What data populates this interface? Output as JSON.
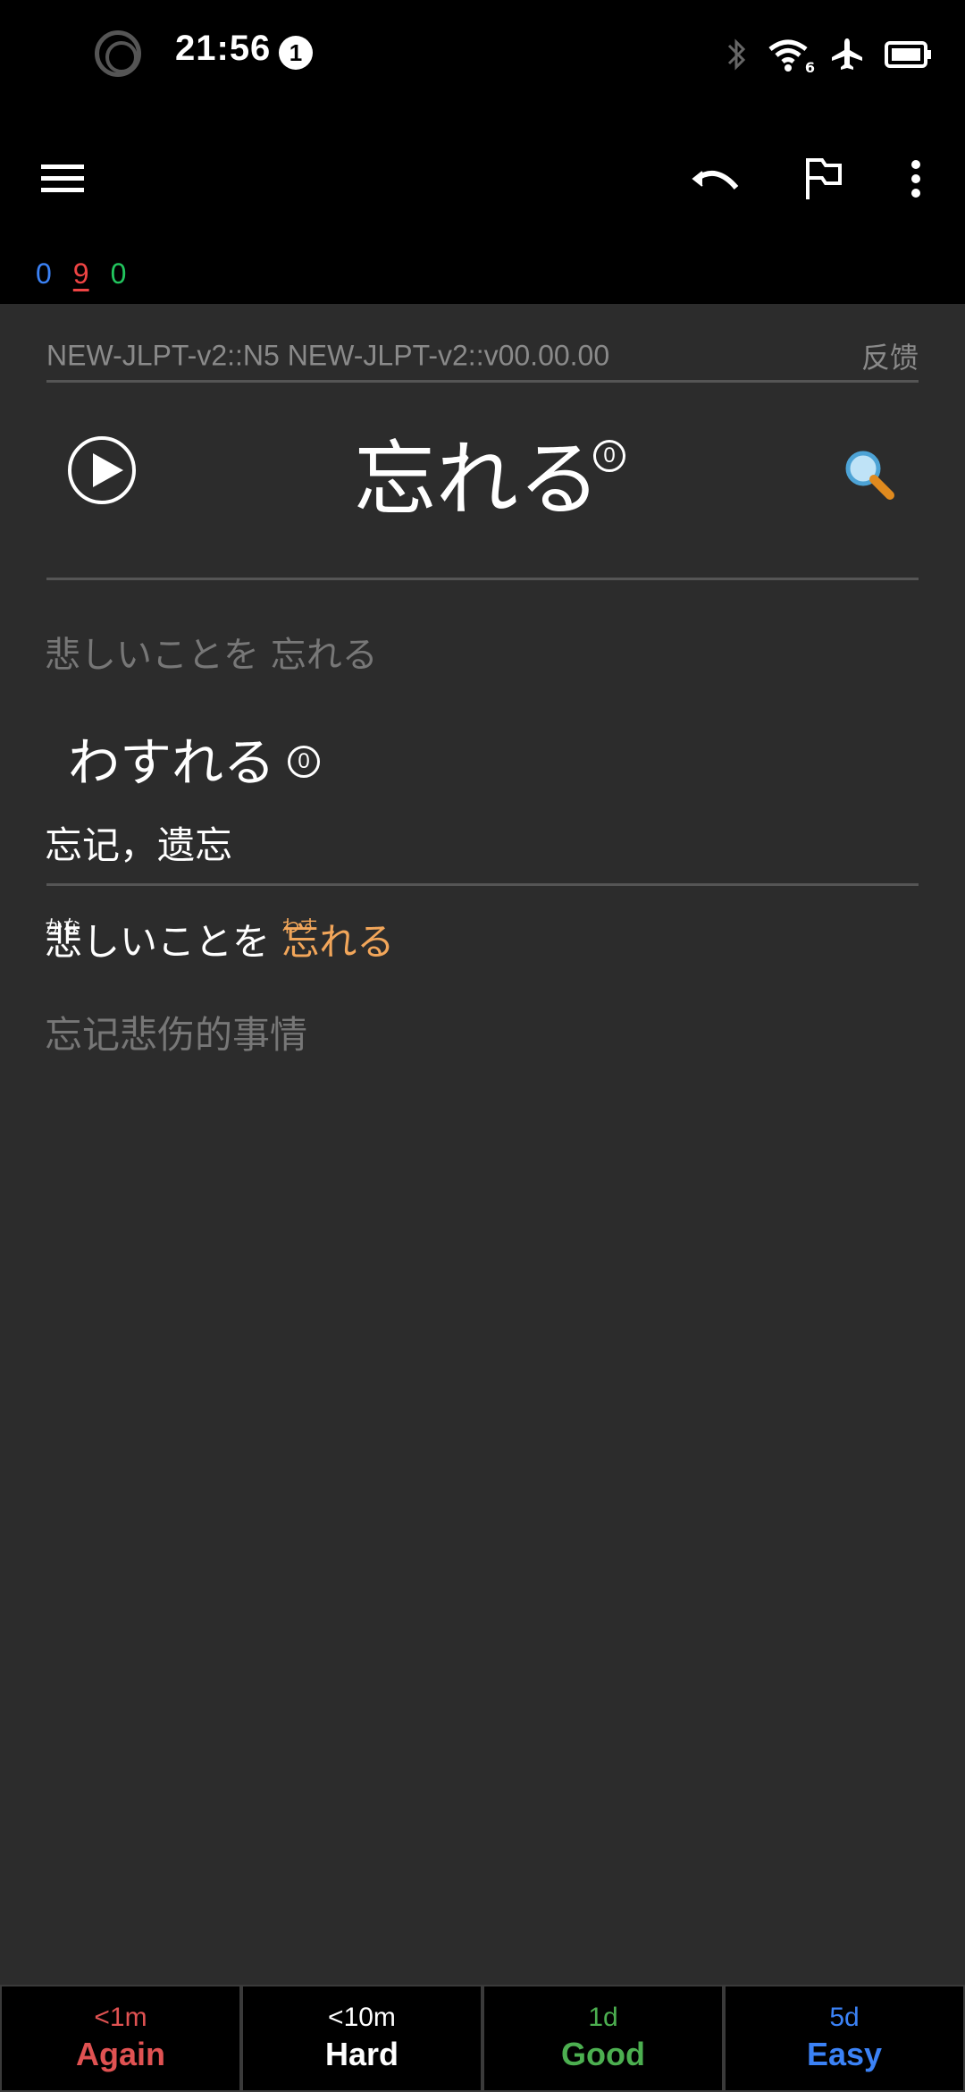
{
  "status_bar": {
    "time": "21:56",
    "notification_count": "1",
    "icons": [
      "bluetooth-icon",
      "wifi-icon",
      "airplane-icon",
      "battery-icon"
    ],
    "wifi_badge": "6"
  },
  "toolbar": {
    "icons": [
      "menu-icon",
      "undo-icon",
      "flag-icon",
      "more-vert-icon"
    ]
  },
  "counts": {
    "new": "0",
    "learning": "9",
    "review": "0"
  },
  "card": {
    "deck": "NEW-JLPT-v2::N5 NEW-JLPT-v2::v00.00.00",
    "feedback": "反馈",
    "headword": "忘れる",
    "pitch": "0",
    "example_hint": "悲しいことを 忘れる",
    "reading": "わすれる",
    "reading_pitch": "0",
    "meaning": "忘记，遗忘",
    "sentence": {
      "part1": "悲",
      "part1_ruby": "かな",
      "part2": "しいことを ",
      "part3": "忘れる",
      "part3_ruby": "わす"
    },
    "translation": "忘记悲伤的事情"
  },
  "answers": [
    {
      "interval": "<1m",
      "label": "Again"
    },
    {
      "interval": "<10m",
      "label": "Hard"
    },
    {
      "interval": "1d",
      "label": "Good"
    },
    {
      "interval": "5d",
      "label": "Easy"
    }
  ],
  "colors": {
    "again": "#e05252",
    "good": "#4caf50",
    "easy": "#3b82f6",
    "highlight": "#f2a65a",
    "card_bg": "#2c2c2c"
  }
}
